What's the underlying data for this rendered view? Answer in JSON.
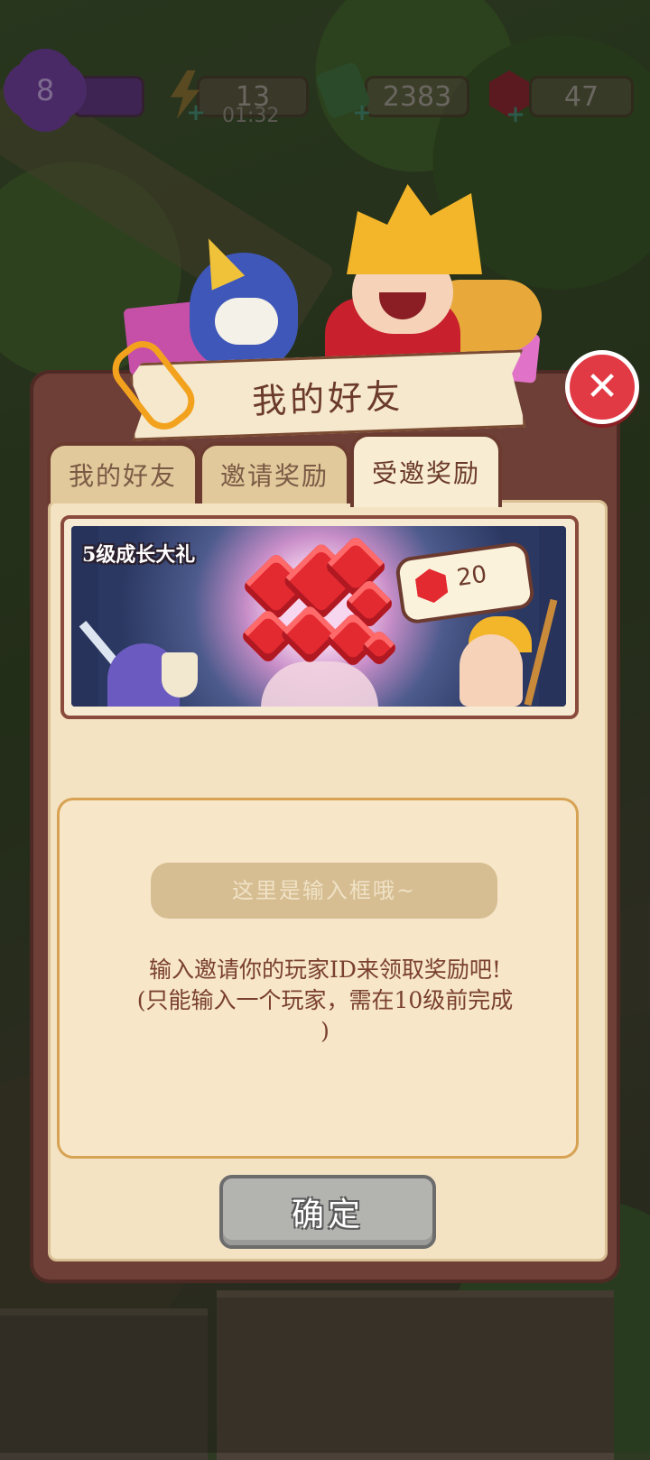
{
  "hud": {
    "level": "8",
    "energy": "13",
    "energy_timer": "01:32",
    "cash": "2383",
    "gems": "47"
  },
  "dialog": {
    "title": "我的好友",
    "tabs": [
      {
        "label": "我的好友",
        "active": false
      },
      {
        "label": "邀请奖励",
        "active": false
      },
      {
        "label": "受邀奖励",
        "active": true
      }
    ],
    "banner": {
      "label": "5级成长大礼",
      "reward_amount": "20"
    },
    "input": {
      "placeholder": "这里是输入框哦~"
    },
    "hint_line1": "输入邀请你的玩家ID来领取奖励吧!",
    "hint_line2": "(只能输入一个玩家，需在10级前完成",
    "hint_line3": ")",
    "confirm_label": "确定"
  },
  "colors": {
    "dialog_frame": "#6e3f36",
    "panel_bg": "#f3e3c3",
    "close_button": "#e23a44",
    "confirm_button": "#b3b3b0",
    "gem_red": "#e22a30"
  },
  "icons": [
    "level-badge-icon",
    "energy-bolt-icon",
    "cash-icon",
    "gem-icon",
    "close-icon",
    "paperclip-icon"
  ]
}
